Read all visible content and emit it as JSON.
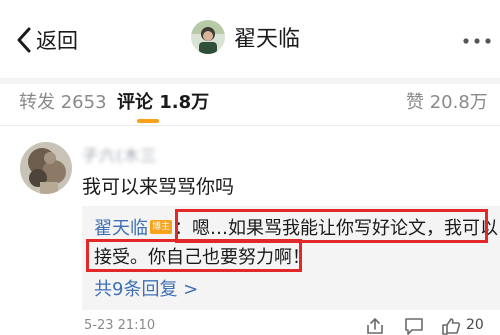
{
  "header": {
    "back_label": "返回",
    "profile_name": "翟天临"
  },
  "tabs": {
    "repost": "转发 2653",
    "comment": "评论 1.8万",
    "like": "赞 20.8万"
  },
  "comment": {
    "username": "子六(木三",
    "text": "我可以来骂骂你吗",
    "reply": {
      "author": "翟天临",
      "badge": "博主",
      "line1": "：嗯…如果骂我能让你写好论文，我可以",
      "line2": "接受。你自己也要努力啊！"
    },
    "view_replies": "共9条回复 >",
    "time": "5-23 21:10",
    "like_count": "20"
  },
  "colors": {
    "accent": "#f7a21a",
    "link": "#3f6fb5",
    "highlight": "#e3282a"
  },
  "icons": [
    "back-chevron-icon",
    "more-icon",
    "share-icon",
    "comment-icon",
    "like-icon"
  ]
}
